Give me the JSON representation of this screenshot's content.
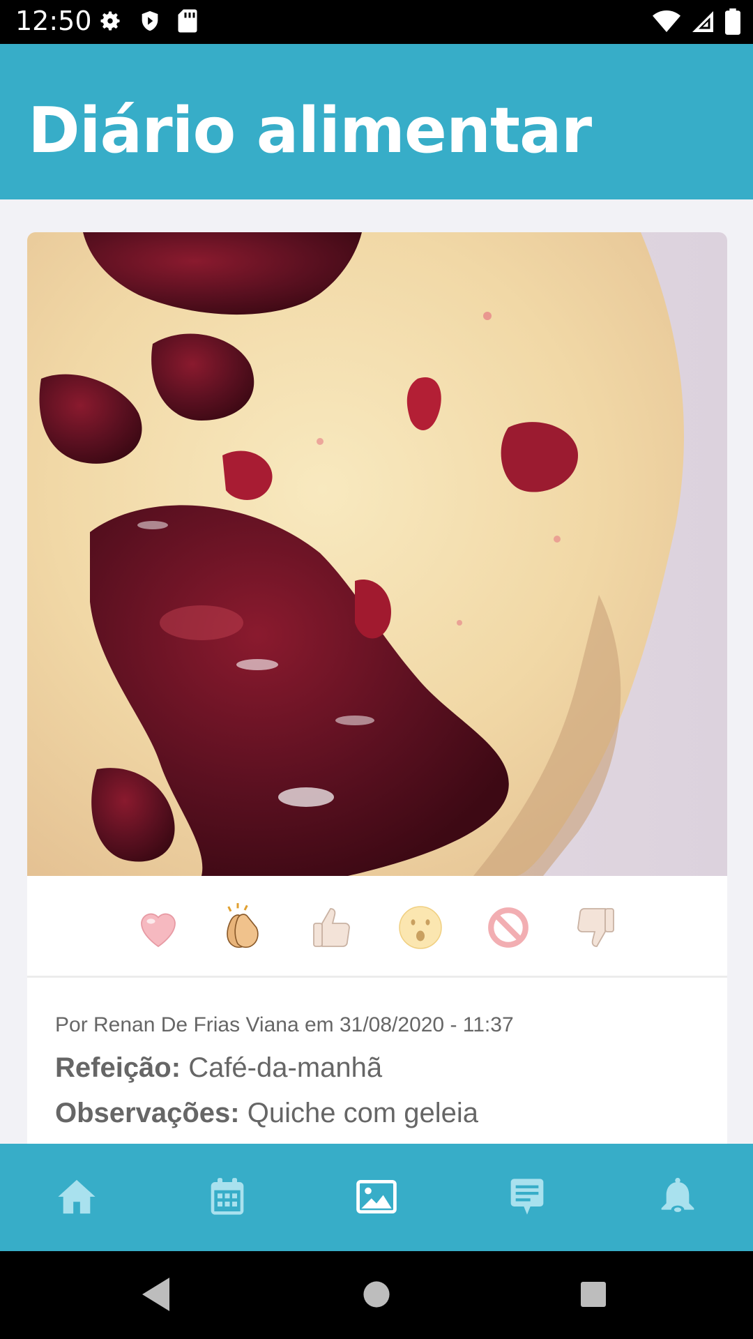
{
  "status_bar": {
    "time": "12:50",
    "icons": [
      "settings-icon",
      "shield-icon",
      "sd-card-icon",
      "wifi-icon",
      "signal-icon",
      "battery-icon"
    ]
  },
  "header": {
    "title": "Diário alimentar",
    "background": "#37adc8"
  },
  "post": {
    "photo_description_icon": "food-photo",
    "reactions": [
      {
        "name": "heart",
        "icon": "heart-icon"
      },
      {
        "name": "clapping",
        "icon": "clapping-hands-icon"
      },
      {
        "name": "thumbs-up",
        "icon": "thumbs-up-icon"
      },
      {
        "name": "surprised",
        "icon": "surprised-face-icon"
      },
      {
        "name": "prohibited",
        "icon": "prohibited-icon"
      },
      {
        "name": "thumbs-down",
        "icon": "thumbs-down-icon"
      }
    ],
    "meta": "Por Renan De Frias Viana em 31/08/2020 - 11:37",
    "meal_label": "Refeição:",
    "meal_value": "Café-da-manhã",
    "notes_label": "Observações:",
    "notes_value": "Quiche com geleia"
  },
  "bottom_nav": {
    "items": [
      {
        "name": "home",
        "icon": "home-icon",
        "active": false
      },
      {
        "name": "calendar",
        "icon": "calendar-icon",
        "active": false
      },
      {
        "name": "gallery",
        "icon": "image-icon",
        "active": true
      },
      {
        "name": "messages",
        "icon": "chat-icon",
        "active": false
      },
      {
        "name": "notifications",
        "icon": "bell-icon",
        "active": false
      }
    ]
  }
}
